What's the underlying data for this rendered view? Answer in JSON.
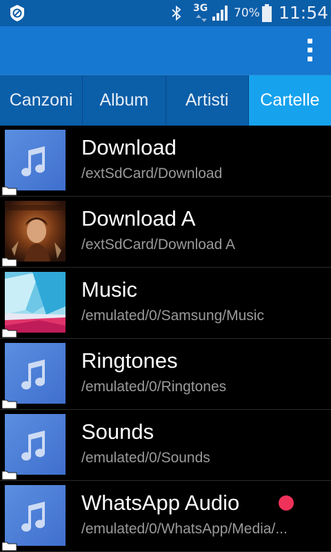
{
  "status_bar": {
    "network": "3G",
    "battery": "70%",
    "time": "11:54"
  },
  "tabs": [
    {
      "label": "Canzoni",
      "active": false
    },
    {
      "label": "Album",
      "active": false
    },
    {
      "label": "Artisti",
      "active": false
    },
    {
      "label": "Cartelle",
      "active": true
    }
  ],
  "folders": [
    {
      "title": "Download",
      "path": "/extSdCard/Download",
      "thumb": "music-note-icon"
    },
    {
      "title": "Download A",
      "path": "/extSdCard/Download A",
      "thumb": "album-cover"
    },
    {
      "title": "Music",
      "path": "/emulated/0/Samsung/Music",
      "thumb": "abstract-cover"
    },
    {
      "title": "Ringtones",
      "path": "/emulated/0/Ringtones",
      "thumb": "music-note-icon"
    },
    {
      "title": "Sounds",
      "path": "/emulated/0/Sounds",
      "thumb": "music-note-icon"
    },
    {
      "title": "WhatsApp Audio",
      "path": "/emulated/0/WhatsApp/Media/...",
      "thumb": "music-note-icon",
      "indicator": "playing-dot"
    }
  ],
  "colors": {
    "status_bar": "#0b5ea8",
    "action_bar": "#1678d1",
    "active_tab": "#17a2ee",
    "indicator": "#f0325a"
  }
}
